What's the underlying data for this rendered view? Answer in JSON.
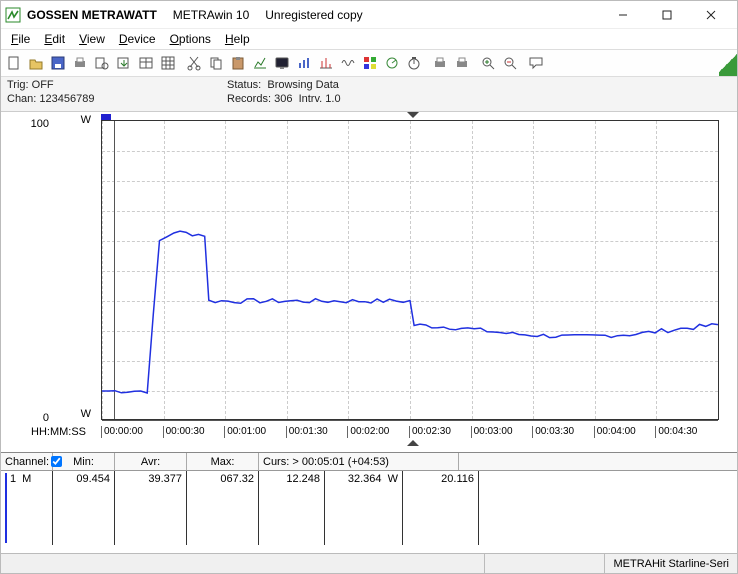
{
  "titlebar": {
    "brand": "GOSSEN METRAWATT",
    "app": "METRAwin 10",
    "registration": "Unregistered copy"
  },
  "menu": [
    "File",
    "Edit",
    "View",
    "Device",
    "Options",
    "Help"
  ],
  "menu_accel": [
    "F",
    "E",
    "V",
    "D",
    "O",
    "H"
  ],
  "toolbar_icons": [
    "new-icon",
    "open-icon",
    "save-icon",
    "print-icon",
    "preview-icon",
    "export-icon",
    "table-icon",
    "grid-icon",
    "spacer",
    "cut-icon",
    "copy-icon",
    "paste-icon",
    "chart-icon",
    "display-icon",
    "bars-icon",
    "stats-icon",
    "wave-icon",
    "color-icon",
    "scan-icon",
    "timer-icon",
    "spacer",
    "printer-icon",
    "printer2-icon",
    "spacer",
    "zoom-in-icon",
    "zoom-out-icon",
    "spacer",
    "bubble-icon"
  ],
  "status": {
    "trig_label": "Trig:",
    "trig_value": "OFF",
    "chan_label": "Chan:",
    "chan_value": "123456789",
    "status_label": "Status:",
    "status_value": "Browsing Data",
    "records_label": "Records:",
    "records_value": "306",
    "intrv_label": "Intrv.",
    "intrv_value": "1.0"
  },
  "chart_data": {
    "type": "line",
    "title": "",
    "xlabel": "HH:MM:SS",
    "ylabel": "",
    "unit": "W",
    "ylim": [
      0,
      100
    ],
    "y_ticks": [
      0,
      100
    ],
    "x_ticks": [
      "00:00:00",
      "00:00:30",
      "00:01:00",
      "00:01:30",
      "00:02:00",
      "00:02:30",
      "00:03:00",
      "00:03:30",
      "00:04:00",
      "00:04:30"
    ],
    "x_range_sec": [
      0,
      300
    ],
    "cursor_sec": 301,
    "cursor_label": "> 00:05:01 (+04:53)",
    "series": [
      {
        "name": "Channel 1",
        "color": "#2030e0",
        "points": [
          {
            "t": 0,
            "y": 10
          },
          {
            "t": 22,
            "y": 10
          },
          {
            "t": 28,
            "y": 60
          },
          {
            "t": 35,
            "y": 63
          },
          {
            "t": 50,
            "y": 62
          },
          {
            "t": 52,
            "y": 40
          },
          {
            "t": 80,
            "y": 40
          },
          {
            "t": 110,
            "y": 40
          },
          {
            "t": 140,
            "y": 40
          },
          {
            "t": 150,
            "y": 40
          },
          {
            "t": 152,
            "y": 32
          },
          {
            "t": 175,
            "y": 31
          },
          {
            "t": 200,
            "y": 29
          },
          {
            "t": 230,
            "y": 28
          },
          {
            "t": 260,
            "y": 29
          },
          {
            "t": 285,
            "y": 31
          },
          {
            "t": 300,
            "y": 32
          }
        ]
      }
    ]
  },
  "table": {
    "headers": {
      "channel": "Channel:",
      "min": "Min:",
      "avr": "Avr:",
      "max": "Max:",
      "curs": "Curs:"
    },
    "checkbox": true,
    "curs_text": "> 00:05:01 (+04:53)",
    "row": {
      "idx": "1",
      "marker": "M",
      "min": "09.454",
      "avr": "39.377",
      "max": "067.32",
      "c4": "12.248",
      "c5": "32.364",
      "c5u": "W",
      "c6": "20.116"
    }
  },
  "footer": {
    "right": "METRAHit Starline-Seri"
  }
}
